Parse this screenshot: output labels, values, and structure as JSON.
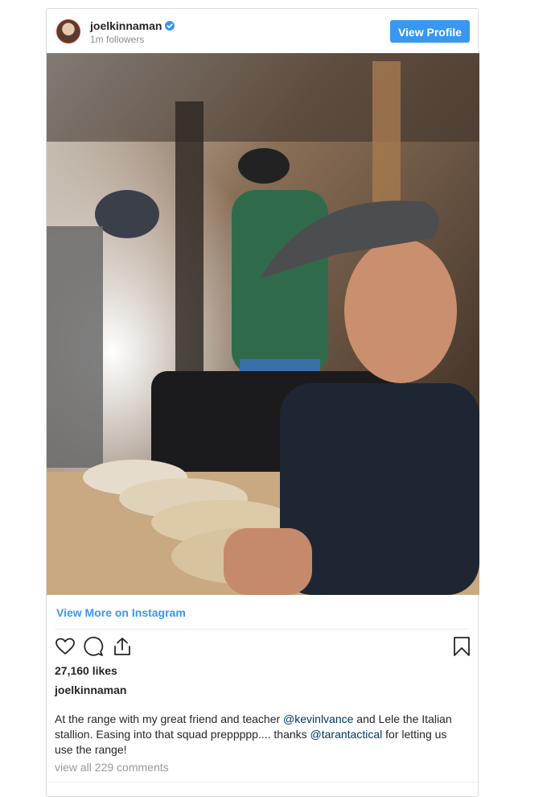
{
  "header": {
    "username": "joelkinnaman",
    "followers": "1m followers",
    "view_profile_label": "View Profile"
  },
  "view_more_label": "View More on Instagram",
  "likes": "27,160 likes",
  "author": "joelkinnaman",
  "caption": {
    "part1": "At the range with my great friend and teacher ",
    "mention1": "@kevinlvance",
    "part2": " and Lele the Italian stallion. Easing into that squad preppppp.... thanks ",
    "mention2": "@tarantactical",
    "part3": " for letting us use the range!"
  },
  "comments_label": "view all 229 comments",
  "colors": {
    "accent": "#3897f0",
    "mention": "#003569",
    "muted": "#8e8e8e"
  },
  "icons": [
    "verified-badge-icon",
    "heart-icon",
    "comment-icon",
    "share-icon",
    "bookmark-icon"
  ]
}
